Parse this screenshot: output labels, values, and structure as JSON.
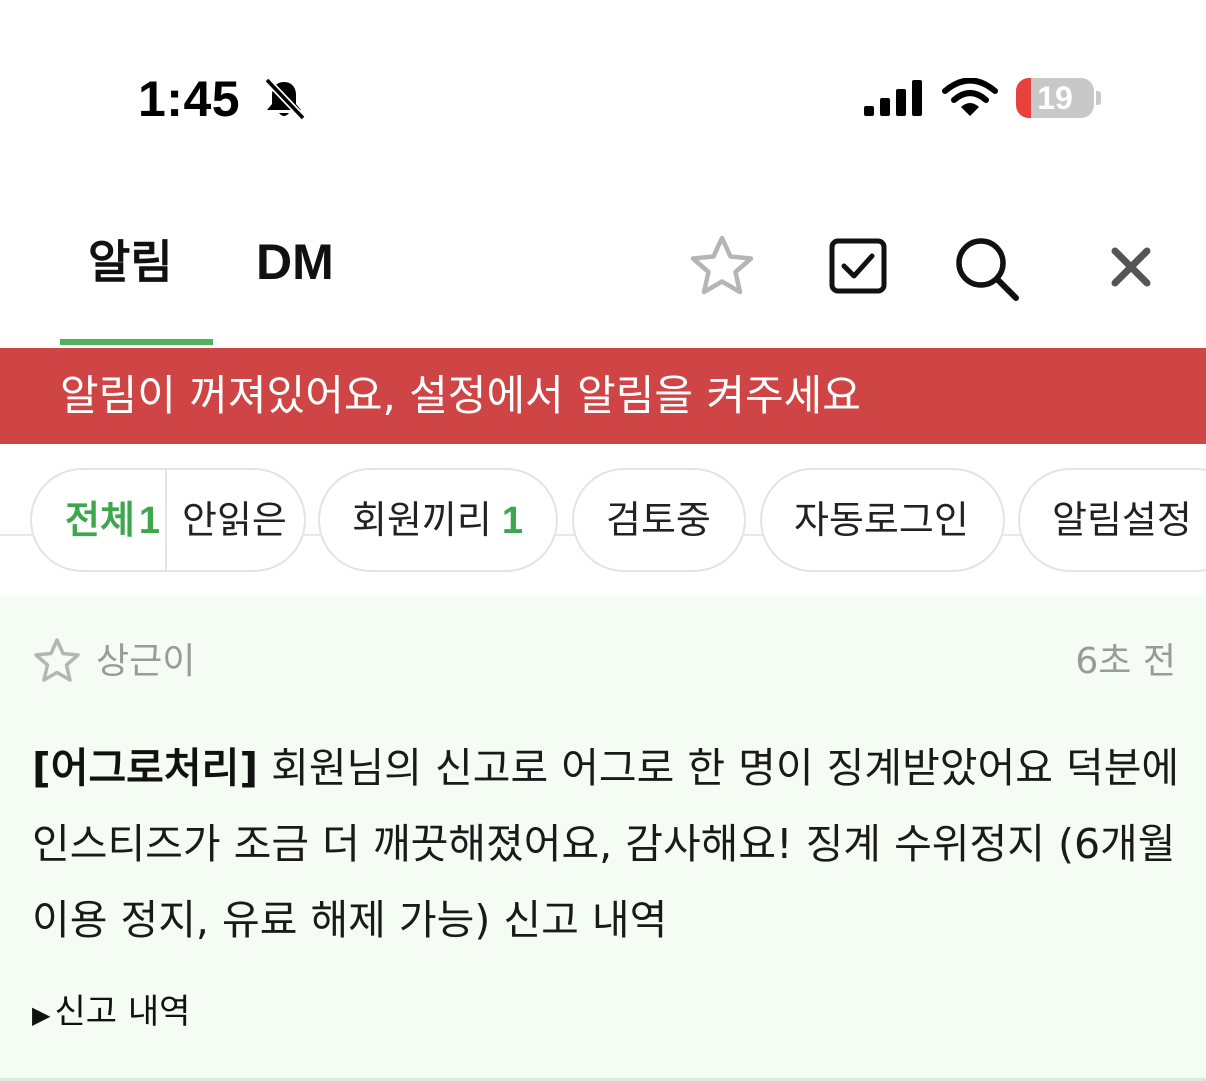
{
  "status_bar": {
    "time": "1:45",
    "battery": {
      "level_text": "19",
      "level_percent": 19
    }
  },
  "header": {
    "tabs": [
      {
        "label": "알림",
        "active": true
      },
      {
        "label": "DM",
        "active": false
      }
    ],
    "icons": [
      "star-icon",
      "checkbox-icon",
      "search-icon",
      "close-icon"
    ]
  },
  "banner": {
    "text": "알림이 꺼져있어요, 설정에서 알림을 켜주세요",
    "color": "#cf4545"
  },
  "filters": {
    "all": {
      "label": "전체",
      "count": "1"
    },
    "unread": {
      "label": "안읽은"
    },
    "members": {
      "label": "회원끼리",
      "count": "1"
    },
    "review": {
      "label": "검토중"
    },
    "autologin": {
      "label": "자동로그인"
    },
    "settings": {
      "label": "알림설정"
    }
  },
  "notification": {
    "user": "상근이",
    "time": "6초 전",
    "tag": "[어그로처리]",
    "body": " 회원님의 신고로 어그로 한 명이 징계받았어요 덕분에 인스티즈가 조금 더 깨끗해졌어요, 감사해요! 징계 수위정지 (6개월 이용 정지, 유료 해제 가능) 신고 내역",
    "link": "신고 내역",
    "link_marker": "▶"
  },
  "colors": {
    "accent_green": "#4cb35a",
    "banner_red": "#cf4545",
    "item_background": "#f5fcf4"
  }
}
